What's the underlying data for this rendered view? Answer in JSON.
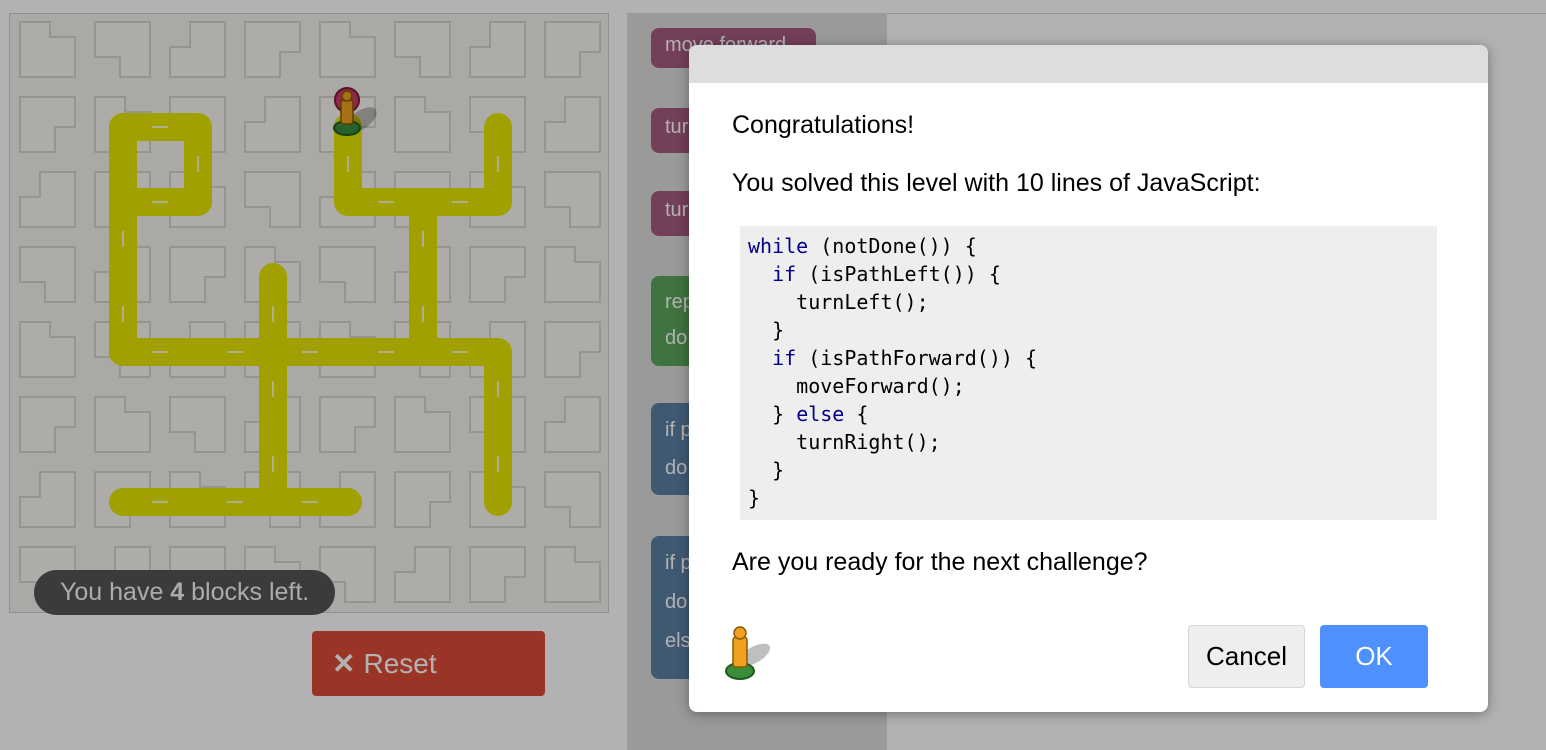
{
  "maze": {
    "blocks_left_prefix": "You have ",
    "blocks_left_count": "4",
    "blocks_left_suffix": " blocks left."
  },
  "controls": {
    "reset_label": "Reset"
  },
  "toolbox": {
    "move_forward": "move forward",
    "turn_left": "tur",
    "turn_right": "tur",
    "repeat": "rep",
    "repeat_do": "do",
    "if_path": "if p",
    "if_do": "do",
    "ifelse_path": "if p",
    "ifelse_do": "do",
    "ifelse_else": "els"
  },
  "dialog": {
    "title": "Congratulations!",
    "message": "You solved this level with 10 lines of JavaScript:",
    "code_lines": [
      {
        "indent": "",
        "kw": "while",
        "rest": " (notDone()) {"
      },
      {
        "indent": "  ",
        "kw": "if",
        "rest": " (isPathLeft()) {"
      },
      {
        "indent": "    ",
        "kw": "",
        "rest": "turnLeft();"
      },
      {
        "indent": "  ",
        "kw": "",
        "rest": "}"
      },
      {
        "indent": "  ",
        "kw": "if",
        "rest": " (isPathForward()) {"
      },
      {
        "indent": "    ",
        "kw": "",
        "rest": "moveForward();"
      },
      {
        "indent": "  ",
        "kw": "",
        "rest": "} ",
        "kw2": "else",
        "rest2": " {"
      },
      {
        "indent": "    ",
        "kw": "",
        "rest": "turnRight();"
      },
      {
        "indent": "  ",
        "kw": "",
        "rest": "}"
      },
      {
        "indent": "",
        "kw": "",
        "rest": "}"
      }
    ],
    "question": "Are you ready for the next challenge?",
    "cancel_label": "Cancel",
    "ok_label": "OK"
  },
  "colors": {
    "path": "#e6e600",
    "reset": "#dd4b39",
    "ok": "#4d90fe",
    "toolbox_movement": "#a55b80",
    "toolbox_loop": "#5ba55b",
    "toolbox_logic": "#5b80a5"
  }
}
